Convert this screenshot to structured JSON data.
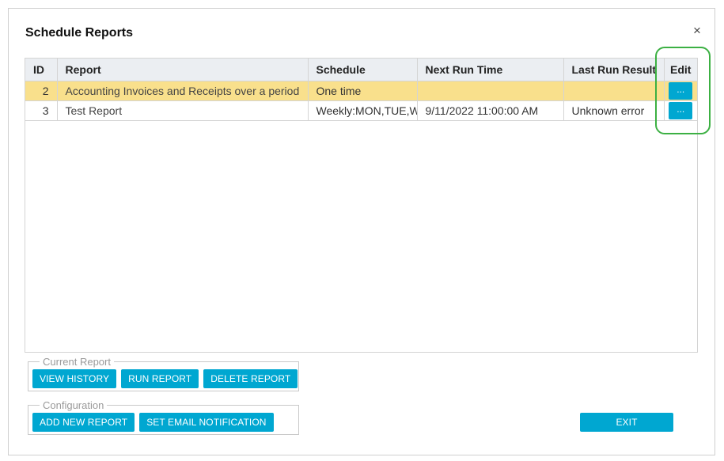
{
  "dialog": {
    "title": "Schedule Reports",
    "close_icon": "close-icon",
    "close_glyph": "×"
  },
  "table": {
    "columns": [
      "ID",
      "Report",
      "Schedule",
      "Next Run Time",
      "Last Run Result",
      "Edit"
    ],
    "rows": [
      {
        "id": "2",
        "report": "Accounting Invoices and Receipts over a period",
        "schedule": "One time",
        "next_run_time": "",
        "last_run_result": "",
        "edit_label": "...",
        "selected": true
      },
      {
        "id": "3",
        "report": "Test Report",
        "schedule": "Weekly:MON,TUE,WED",
        "next_run_time": "9/11/2022 11:00:00 AM",
        "last_run_result": "Unknown error",
        "edit_label": "...",
        "selected": false
      }
    ]
  },
  "current_report": {
    "legend": "Current Report",
    "view_history_label": "VIEW HISTORY",
    "run_report_label": "RUN REPORT",
    "delete_report_label": "DELETE REPORT"
  },
  "configuration": {
    "legend": "Configuration",
    "add_new_report_label": "ADD NEW REPORT",
    "set_email_notification_label": "SET EMAIL NOTIFICATION"
  },
  "exit_label": "EXIT",
  "colors": {
    "accent": "#00a7d1",
    "selected_row": "#f9e08c",
    "header_bg": "#ebeef2",
    "highlight_outline": "#3cb043"
  }
}
